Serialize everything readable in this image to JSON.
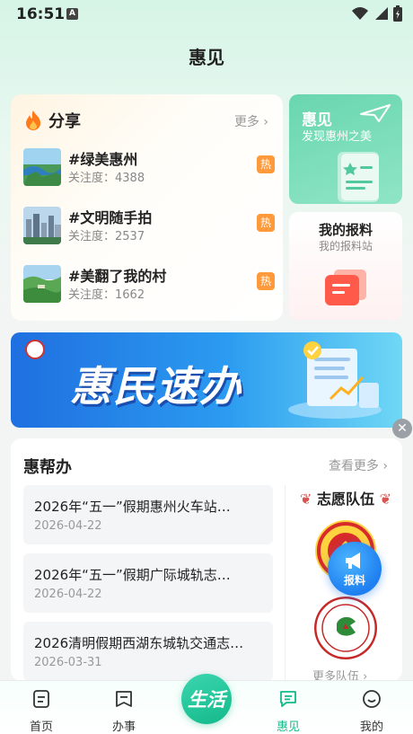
{
  "status": {
    "time": "16:51",
    "notification": "A"
  },
  "header": {
    "title": "惠见"
  },
  "share": {
    "title": "分享",
    "more": "更多",
    "items": [
      {
        "name": "#绿美惠州",
        "stat": "关注度：4388",
        "badge": "热"
      },
      {
        "name": "#文明随手拍",
        "stat": "关注度：2537",
        "badge": "热"
      },
      {
        "name": "#美翻了我的村",
        "stat": "关注度：1662",
        "badge": "热"
      }
    ]
  },
  "promo": {
    "title": "惠见",
    "subtitle": "发现惠州之美"
  },
  "report": {
    "title": "我的报料",
    "subtitle": "我的报料站"
  },
  "banner": {
    "text": "惠民速办"
  },
  "help": {
    "title": "惠帮办",
    "more": "查看更多",
    "news": [
      {
        "title": "2026年“五一”假期惠州火车站…",
        "date": "2026-04-22"
      },
      {
        "title": "2026年“五一”假期广际城轨志…",
        "date": "2026-04-22"
      },
      {
        "title": "2026清明假期西湖东城轨交通志…",
        "date": "2026-03-31"
      }
    ],
    "volunteer": {
      "title": "志愿队伍",
      "more": "更多队伍"
    }
  },
  "fab": {
    "label": "报料"
  },
  "nav": {
    "items": [
      {
        "label": "首页",
        "icon": "home-icon"
      },
      {
        "label": "办事",
        "icon": "bookmark-icon"
      },
      {
        "label": "惠见",
        "icon": "chat-icon",
        "active": true
      },
      {
        "label": "我的",
        "icon": "smile-icon"
      }
    ],
    "center": "生活"
  },
  "colors": {
    "accent": "#14b98a",
    "hot": "#ff9a3c",
    "banner": "#1f6fe0"
  }
}
